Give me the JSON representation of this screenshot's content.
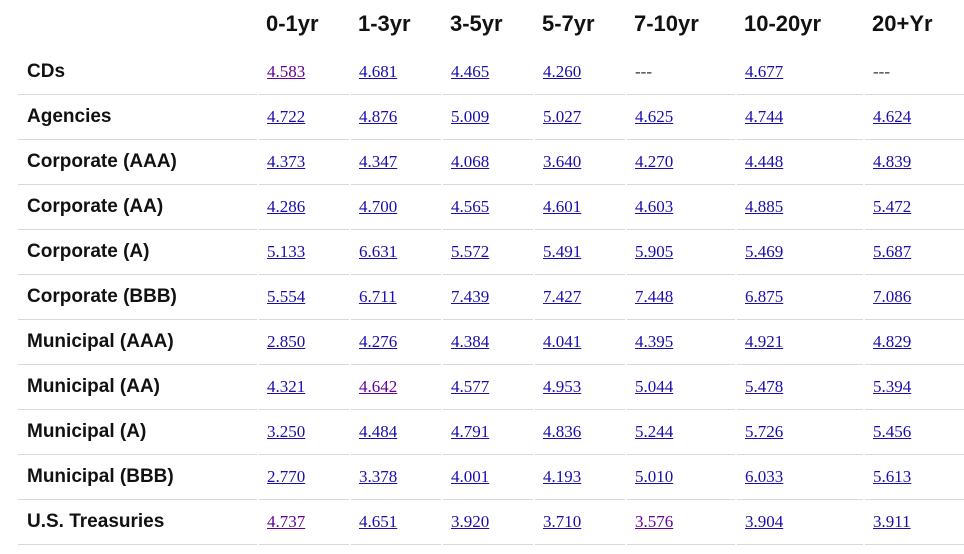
{
  "columns": [
    "0-1yr",
    "1-3yr",
    "3-5yr",
    "5-7yr",
    "7-10yr",
    "10-20yr",
    "20+Yr"
  ],
  "rows": [
    {
      "label": "CDs",
      "values": [
        "4.583",
        "4.681",
        "4.465",
        "4.260",
        "---",
        "4.677",
        "---"
      ],
      "visited": [
        true,
        false,
        false,
        false,
        false,
        false,
        false
      ]
    },
    {
      "label": "Agencies",
      "values": [
        "4.722",
        "4.876",
        "5.009",
        "5.027",
        "4.625",
        "4.744",
        "4.624"
      ],
      "visited": [
        false,
        false,
        false,
        false,
        false,
        false,
        false
      ]
    },
    {
      "label": "Corporate (AAA)",
      "values": [
        "4.373",
        "4.347",
        "4.068",
        "3.640",
        "4.270",
        "4.448",
        "4.839"
      ],
      "visited": [
        false,
        false,
        false,
        false,
        false,
        false,
        false
      ]
    },
    {
      "label": "Corporate (AA)",
      "values": [
        "4.286",
        "4.700",
        "4.565",
        "4.601",
        "4.603",
        "4.885",
        "5.472"
      ],
      "visited": [
        false,
        false,
        false,
        false,
        false,
        false,
        false
      ]
    },
    {
      "label": "Corporate (A)",
      "values": [
        "5.133",
        "6.631",
        "5.572",
        "5.491",
        "5.905",
        "5.469",
        "5.687"
      ],
      "visited": [
        false,
        false,
        false,
        false,
        false,
        false,
        false
      ]
    },
    {
      "label": "Corporate (BBB)",
      "values": [
        "5.554",
        "6.711",
        "7.439",
        "7.427",
        "7.448",
        "6.875",
        "7.086"
      ],
      "visited": [
        false,
        false,
        false,
        false,
        false,
        false,
        false
      ]
    },
    {
      "label": "Municipal (AAA)",
      "values": [
        "2.850",
        "4.276",
        "4.384",
        "4.041",
        "4.395",
        "4.921",
        "4.829"
      ],
      "visited": [
        false,
        false,
        false,
        false,
        false,
        false,
        false
      ]
    },
    {
      "label": "Municipal (AA)",
      "values": [
        "4.321",
        "4.642",
        "4.577",
        "4.953",
        "5.044",
        "5.478",
        "5.394"
      ],
      "visited": [
        false,
        true,
        false,
        false,
        false,
        false,
        false
      ]
    },
    {
      "label": "Municipal (A)",
      "values": [
        "3.250",
        "4.484",
        "4.791",
        "4.836",
        "5.244",
        "5.726",
        "5.456"
      ],
      "visited": [
        false,
        false,
        false,
        false,
        false,
        false,
        false
      ]
    },
    {
      "label": "Municipal (BBB)",
      "values": [
        "2.770",
        "3.378",
        "4.001",
        "4.193",
        "5.010",
        "6.033",
        "5.613"
      ],
      "visited": [
        false,
        false,
        false,
        false,
        false,
        false,
        false
      ]
    },
    {
      "label": "U.S. Treasuries",
      "values": [
        "4.737",
        "4.651",
        "3.920",
        "3.710",
        "3.576",
        "3.904",
        "3.911"
      ],
      "visited": [
        true,
        false,
        false,
        false,
        true,
        false,
        false
      ]
    }
  ],
  "colors": {
    "link": "#1a0dab",
    "visited_link": "#660099",
    "divider": "#d9d9d9"
  }
}
